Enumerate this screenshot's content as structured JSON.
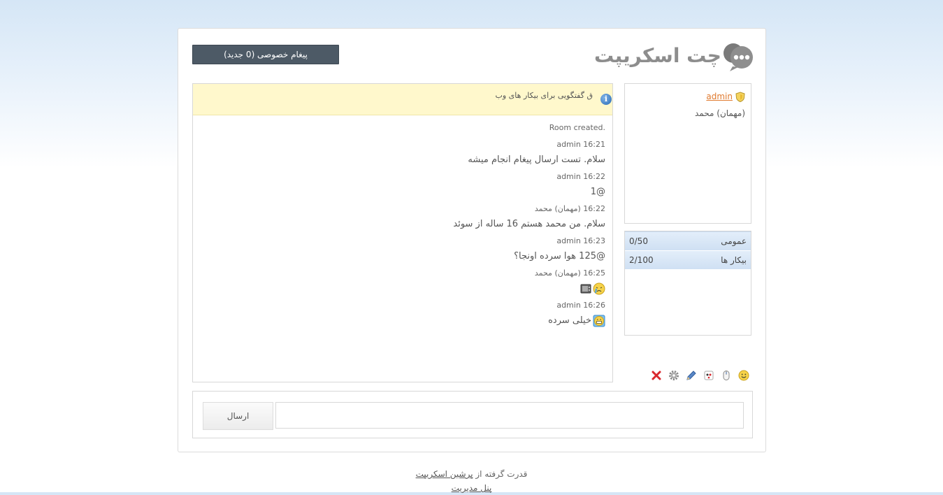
{
  "logo": {
    "text": "چت اسکریپت",
    "icon": "chat-bubbles-logo-icon"
  },
  "header": {
    "pm_button_label": "پیغام خصوصی (0 جدید)"
  },
  "users": [
    {
      "name": "admin",
      "role": "admin",
      "icon": "shield-icon"
    },
    {
      "name": "(مهمان) محمد",
      "role": "guest"
    }
  ],
  "rooms": [
    {
      "name": "عمومی",
      "count": "0/50"
    },
    {
      "name": "بیکار ها",
      "count": "2/100"
    }
  ],
  "chat": {
    "topic": "ق گفتگویی برای بیکار های وب",
    "system_message": "Room created.",
    "messages": [
      {
        "time": "16:21",
        "sender": "admin",
        "text": "سلام. تست ارسال پیغام انجام میشه"
      },
      {
        "time": "16:22",
        "sender": "admin",
        "text": "@1"
      },
      {
        "time": "16:22",
        "sender": "(مهمان) محمد",
        "text": "سلام. من محمد هستم 16 ساله از سوئد"
      },
      {
        "time": "16:23",
        "sender": "admin",
        "text": "@125 هوا سرده اونجا؟"
      },
      {
        "time": "16:25",
        "sender": "(مهمان) محمد",
        "text": "",
        "emoticons": [
          "crying-emoticon",
          "tv-emoticon"
        ]
      },
      {
        "time": "16:26",
        "sender": "admin",
        "text": "خیلی سرده",
        "emoticons": [
          "grin-emoticon"
        ]
      }
    ]
  },
  "toolbar": {
    "icons": [
      "close-icon",
      "settings-gear-icon",
      "pencil-icon",
      "emoticon-picker-icon",
      "mouse-icon",
      "smiley-icon"
    ]
  },
  "input": {
    "send_label": "ارسال",
    "placeholder": ""
  },
  "footer": {
    "powered_prefix": "قدرت گرفته از",
    "powered_link": "پرشین اسکریپت",
    "admin_link": "پنل مدیریت"
  },
  "colors": {
    "accent_dark": "#4d5a66",
    "admin_name": "#e07a2e",
    "topic_bg": "#fff8cc",
    "room_bg": "#d9e7f6"
  }
}
